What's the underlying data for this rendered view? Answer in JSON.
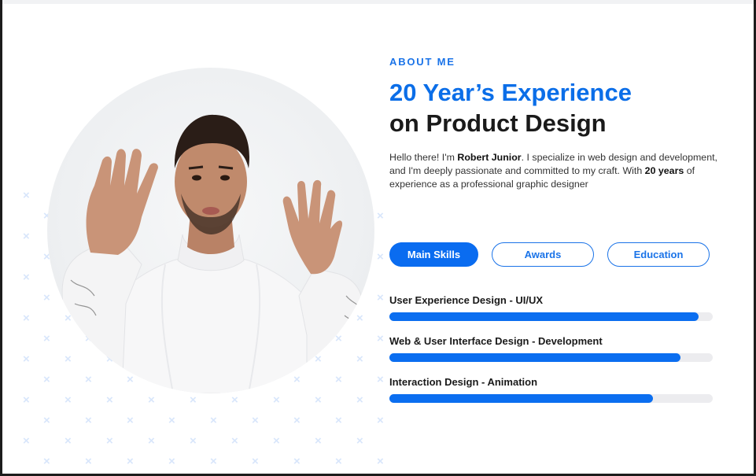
{
  "about": {
    "eyebrow": "ABOUT ME",
    "heading_line1": "20 Year’s Experience",
    "heading_line2": "on Product Design",
    "intro_pre": "Hello there! I'm ",
    "intro_name": "Robert Junior",
    "intro_mid": ". I specialize in web design and development, and I'm deeply passionate and committed to my craft. With ",
    "intro_years": "20 years",
    "intro_post": " of experience as a professional graphic designer"
  },
  "tabs": [
    {
      "label": "Main Skills",
      "active": true
    },
    {
      "label": "Awards",
      "active": false
    },
    {
      "label": "Education",
      "active": false
    }
  ],
  "skills": [
    {
      "label": "User Experience Design - UI/UX",
      "progress": 0.955
    },
    {
      "label": "Web & User Interface Design - Development",
      "progress": 0.9
    },
    {
      "label": "Interaction Design - Animation",
      "progress": 0.815
    }
  ],
  "colors": {
    "accent": "#0b6ef0",
    "heading_dark": "#1a1a1a",
    "track": "#ececef"
  },
  "photo": {
    "icon": "portrait-photo"
  }
}
